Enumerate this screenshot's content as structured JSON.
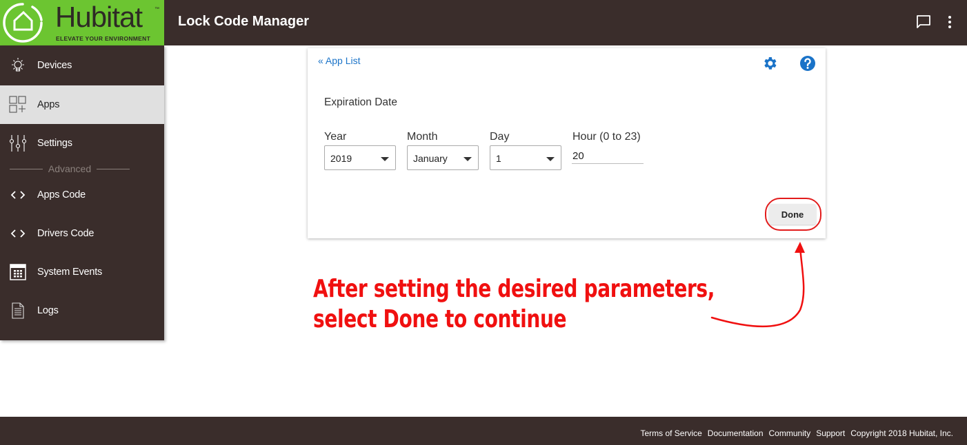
{
  "brand": {
    "name": "Hubitat",
    "trademark": "™",
    "tagline": "ELEVATE YOUR ENVIRONMENT",
    "color": "#6cc531"
  },
  "header": {
    "title": "Lock Code Manager",
    "icons": [
      "chat-icon",
      "more-vert-icon"
    ]
  },
  "sidebar": {
    "items": [
      {
        "label": "Devices",
        "icon": "lightbulb-icon",
        "active": false
      },
      {
        "label": "Apps",
        "icon": "apps-grid-icon",
        "active": true
      },
      {
        "label": "Settings",
        "icon": "sliders-icon",
        "active": false
      }
    ],
    "section_label": "Advanced",
    "advanced_items": [
      {
        "label": "Apps Code",
        "icon": "code-icon"
      },
      {
        "label": "Drivers Code",
        "icon": "code-icon"
      },
      {
        "label": "System Events",
        "icon": "calendar-icon"
      },
      {
        "label": "Logs",
        "icon": "document-icon"
      }
    ]
  },
  "card": {
    "back_link": "« App List",
    "section_title": "Expiration Date",
    "fields": {
      "year": {
        "label": "Year",
        "value": "2019"
      },
      "month": {
        "label": "Month",
        "value": "January"
      },
      "day": {
        "label": "Day",
        "value": "1"
      },
      "hour": {
        "label": "Hour (0 to 23)",
        "value": "20"
      }
    },
    "done_label": "Done",
    "accent": "#1a73c8"
  },
  "annotation": {
    "line1": "After setting the desired parameters,",
    "line2": "select Done to continue",
    "color": "#f01010"
  },
  "footer": {
    "links": [
      "Terms of Service",
      "Documentation",
      "Community",
      "Support"
    ],
    "copyright": "Copyright 2018 Hubitat, Inc."
  }
}
